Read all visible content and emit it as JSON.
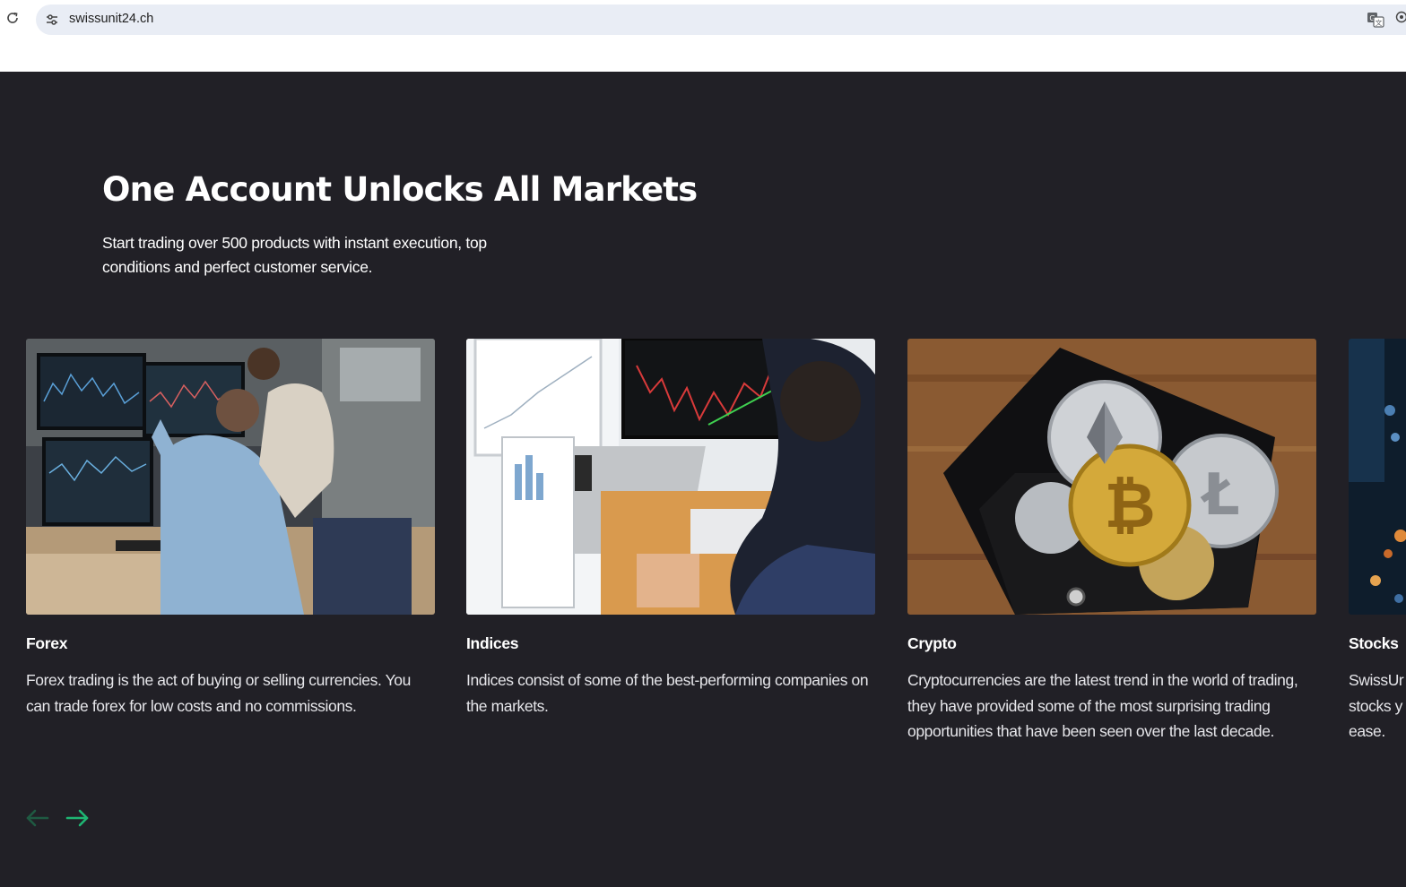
{
  "browser": {
    "url": "swissunit24.ch",
    "icons": [
      "reload-icon",
      "site-info-icon",
      "translate-icon",
      "extension-icon"
    ]
  },
  "hero": {
    "title": "One Account Unlocks All Markets",
    "subtitle": "Start trading over 500 products with instant execution, top conditions and perfect customer service."
  },
  "cards": [
    {
      "title": "Forex",
      "text": "Forex trading is the act of buying or selling currencies. You can trade forex for low costs and no commissions.",
      "image": "traders-at-monitors-photo"
    },
    {
      "title": "Indices",
      "text": "Indices consist of some of the best-performing companies on the markets.",
      "image": "laptop-charts-photo"
    },
    {
      "title": "Crypto",
      "text": "Cryptocurrencies are the latest trend in the world of trading, they have provided some of the most surprising trading opportunities that have been seen over the last decade.",
      "image": "crypto-coins-wallet-photo"
    },
    {
      "title": "Stocks",
      "text": "SwissUr stocks y ease.",
      "image": "city-lights-photo"
    }
  ],
  "carousel": {
    "icons": [
      "arrow-left-icon",
      "arrow-right-icon"
    ],
    "colors": {
      "prev": "#1f5a42",
      "next": "#1fb673"
    }
  },
  "colors": {
    "background": "#212026",
    "text": "#ffffff",
    "accent": "#1fb673"
  }
}
